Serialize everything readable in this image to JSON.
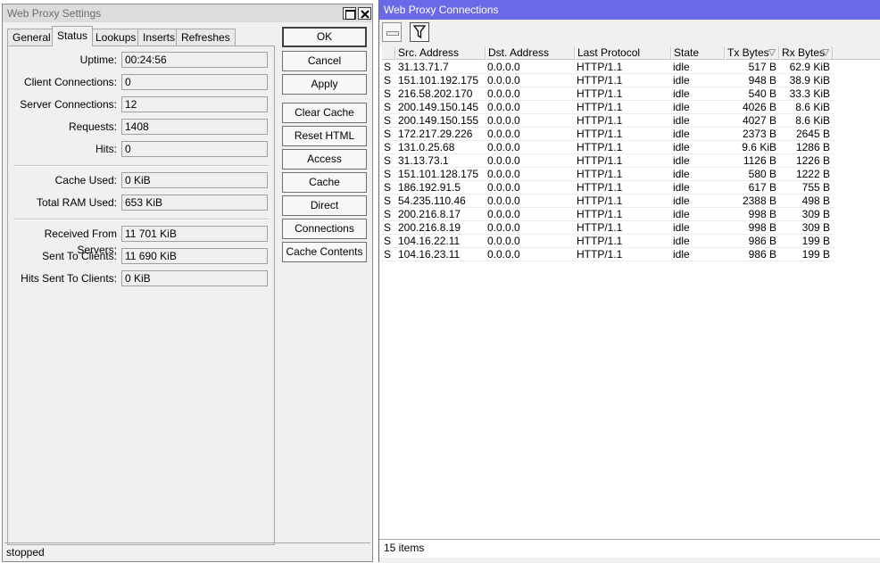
{
  "settings_window": {
    "title": "Web Proxy Settings",
    "tabs": [
      {
        "label": "General"
      },
      {
        "label": "Status"
      },
      {
        "label": "Lookups"
      },
      {
        "label": "Inserts"
      },
      {
        "label": "Refreshes"
      }
    ],
    "active_tab": "Status",
    "fields": [
      {
        "label": "Uptime:",
        "value": "00:24:56"
      },
      {
        "label": "Client Connections:",
        "value": "0"
      },
      {
        "label": "Server Connections:",
        "value": "12"
      },
      {
        "label": "Requests:",
        "value": "1408"
      },
      {
        "label": "Hits:",
        "value": "0"
      },
      {
        "label": "Cache Used:",
        "value": "0 KiB"
      },
      {
        "label": "Total RAM Used:",
        "value": "653 KiB"
      },
      {
        "label": "Received From Servers:",
        "value": "11 701 KiB"
      },
      {
        "label": "Sent To Clients:",
        "value": "11 690 KiB"
      },
      {
        "label": "Hits Sent To Clients:",
        "value": "0 KiB"
      }
    ],
    "buttons": {
      "ok": "OK",
      "cancel": "Cancel",
      "apply": "Apply",
      "clear_cache": "Clear Cache",
      "reset_html": "Reset HTML",
      "access": "Access",
      "cache": "Cache",
      "direct": "Direct",
      "connections": "Connections",
      "cache_contents": "Cache Contents"
    },
    "status_text": "stopped"
  },
  "connections_window": {
    "title": "Web Proxy Connections",
    "toolbar_icons": [
      "minus-icon",
      "filter-icon"
    ],
    "columns": [
      "Src. Address",
      "Dst. Address",
      "Last Protocol",
      "State",
      "Tx Bytes",
      "Rx Bytes"
    ],
    "rows": [
      {
        "flag": "S",
        "src": "31.13.71.7",
        "dst": "0.0.0.0",
        "proto": "HTTP/1.1",
        "state": "idle",
        "tx": "517 B",
        "rx": "62.9 KiB"
      },
      {
        "flag": "S",
        "src": "151.101.192.175",
        "dst": "0.0.0.0",
        "proto": "HTTP/1.1",
        "state": "idle",
        "tx": "948 B",
        "rx": "38.9 KiB"
      },
      {
        "flag": "S",
        "src": "216.58.202.170",
        "dst": "0.0.0.0",
        "proto": "HTTP/1.1",
        "state": "idle",
        "tx": "540 B",
        "rx": "33.3 KiB"
      },
      {
        "flag": "S",
        "src": "200.149.150.145",
        "dst": "0.0.0.0",
        "proto": "HTTP/1.1",
        "state": "idle",
        "tx": "4026 B",
        "rx": "8.6 KiB"
      },
      {
        "flag": "S",
        "src": "200.149.150.155",
        "dst": "0.0.0.0",
        "proto": "HTTP/1.1",
        "state": "idle",
        "tx": "4027 B",
        "rx": "8.6 KiB"
      },
      {
        "flag": "S",
        "src": "172.217.29.226",
        "dst": "0.0.0.0",
        "proto": "HTTP/1.1",
        "state": "idle",
        "tx": "2373 B",
        "rx": "2645 B"
      },
      {
        "flag": "S",
        "src": "131.0.25.68",
        "dst": "0.0.0.0",
        "proto": "HTTP/1.1",
        "state": "idle",
        "tx": "9.6 KiB",
        "rx": "1286 B"
      },
      {
        "flag": "S",
        "src": "31.13.73.1",
        "dst": "0.0.0.0",
        "proto": "HTTP/1.1",
        "state": "idle",
        "tx": "1126 B",
        "rx": "1226 B"
      },
      {
        "flag": "S",
        "src": "151.101.128.175",
        "dst": "0.0.0.0",
        "proto": "HTTP/1.1",
        "state": "idle",
        "tx": "580 B",
        "rx": "1222 B"
      },
      {
        "flag": "S",
        "src": "186.192.91.5",
        "dst": "0.0.0.0",
        "proto": "HTTP/1.1",
        "state": "idle",
        "tx": "617 B",
        "rx": "755 B"
      },
      {
        "flag": "S",
        "src": "54.235.110.46",
        "dst": "0.0.0.0",
        "proto": "HTTP/1.1",
        "state": "idle",
        "tx": "2388 B",
        "rx": "498 B"
      },
      {
        "flag": "S",
        "src": "200.216.8.17",
        "dst": "0.0.0.0",
        "proto": "HTTP/1.1",
        "state": "idle",
        "tx": "998 B",
        "rx": "309 B"
      },
      {
        "flag": "S",
        "src": "200.216.8.19",
        "dst": "0.0.0.0",
        "proto": "HTTP/1.1",
        "state": "idle",
        "tx": "998 B",
        "rx": "309 B"
      },
      {
        "flag": "S",
        "src": "104.16.22.11",
        "dst": "0.0.0.0",
        "proto": "HTTP/1.1",
        "state": "idle",
        "tx": "986 B",
        "rx": "199 B"
      },
      {
        "flag": "S",
        "src": "104.16.23.11",
        "dst": "0.0.0.0",
        "proto": "HTTP/1.1",
        "state": "idle",
        "tx": "986 B",
        "rx": "199 B"
      }
    ],
    "status_text": "15 items"
  },
  "colors": {
    "title_active": "#6a6ae8",
    "title_inactive": "#dcdcdc",
    "window_bg": "#f0f0f0"
  }
}
